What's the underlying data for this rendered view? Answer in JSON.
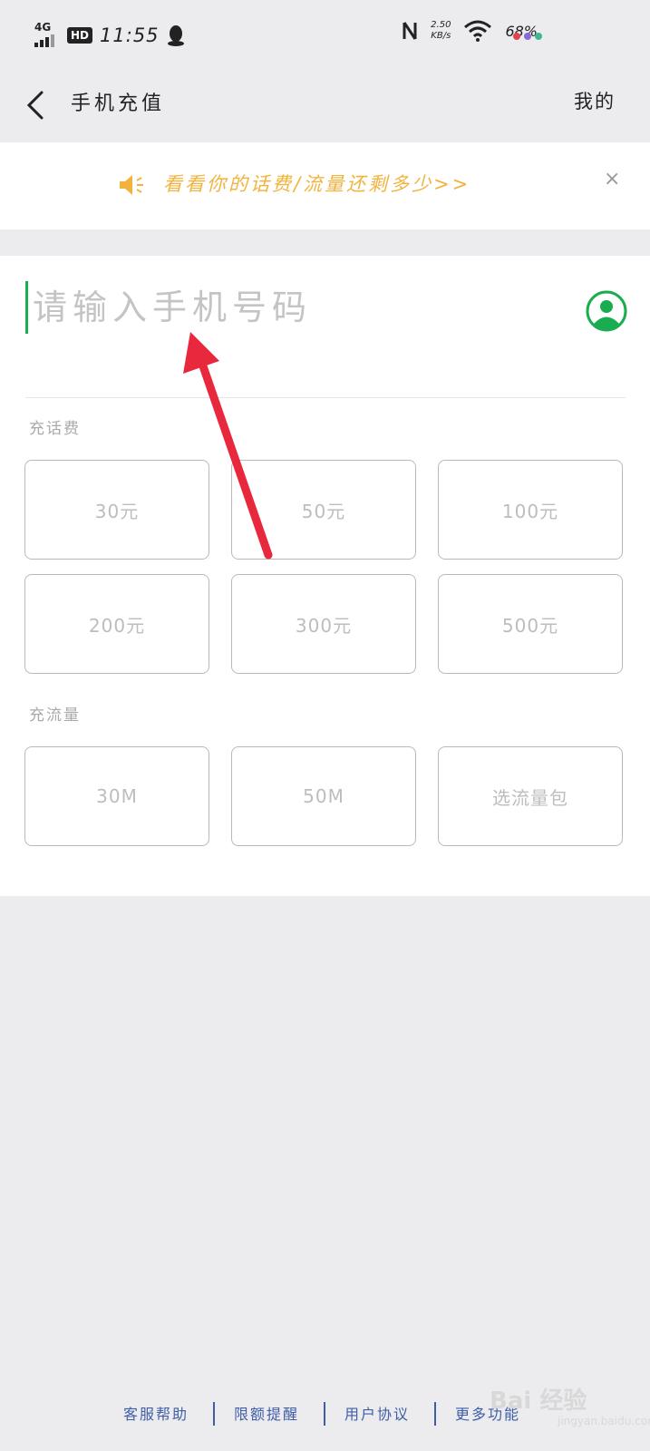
{
  "status_bar": {
    "network": "4G",
    "hd": "HD",
    "time": "11:55",
    "speed_value": "2.50",
    "speed_unit": "KB/s",
    "battery": "68%",
    "dot_colors": [
      "#e0454f",
      "#8a6bd1",
      "#3fb88c"
    ]
  },
  "header": {
    "title": "手机充值",
    "right_link": "我的"
  },
  "notice": {
    "text": "看看你的话费/流量还剩多少>>",
    "close": "×",
    "color": "#f2b33d"
  },
  "phone_input": {
    "placeholder": "请输入手机号码",
    "value": ""
  },
  "sections": {
    "bill_label": "充话费",
    "data_label": "充流量"
  },
  "bill_options": [
    "30元",
    "50元",
    "100元",
    "200元",
    "300元",
    "500元"
  ],
  "data_options": [
    "30M",
    "50M",
    "选流量包"
  ],
  "footer": {
    "links": [
      "客服帮助",
      "限额提醒",
      "用户协议",
      "更多功能"
    ]
  },
  "watermark": {
    "text": "Bai 经验",
    "sub": "jingyan.baidu.com"
  },
  "colors": {
    "accent": "#1aad50",
    "arrow": "#e8283c",
    "footer_link": "#3f5ea8"
  }
}
